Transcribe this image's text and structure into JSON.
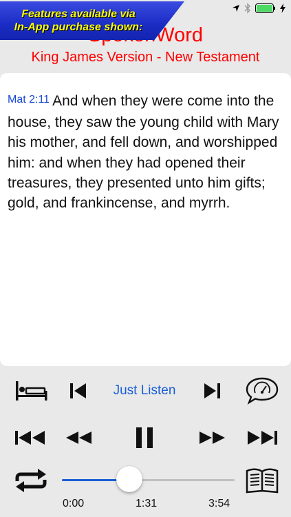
{
  "promo": {
    "line1": "Features available via",
    "line2": "In-App purchase shown:"
  },
  "header": {
    "title": "SpokenWord",
    "subtitle": "King James Version - New Testament"
  },
  "reader": {
    "verse_ref": "Mat 2:11",
    "verse_text": "And when they were come into the house, they saw the young child with Mary his mother, and fell down, and worshipped him: and when they had opened their treasures, they presented unto him gifts; gold, and frankincense, and myrrh."
  },
  "mode": {
    "label": "Just Listen"
  },
  "player": {
    "progress": 0.39,
    "time_start": "0:00",
    "time_current": "1:31",
    "time_end": "3:54"
  },
  "icons": {
    "status": [
      "location-icon",
      "bluetooth-icon",
      "battery-icon",
      "charging-icon"
    ],
    "controls": [
      "sleep-timer-icon",
      "previous-verse-icon",
      "next-verse-icon",
      "speed-icon",
      "skip-to-start-icon",
      "rewind-icon",
      "pause-icon",
      "fast-forward-icon",
      "skip-to-end-icon",
      "repeat-icon",
      "book-icon"
    ]
  },
  "colors": {
    "accent": "#1a5fd6",
    "title": "#ff0000",
    "promo_text": "#ffff00",
    "promo_bg": "#2236d0"
  }
}
